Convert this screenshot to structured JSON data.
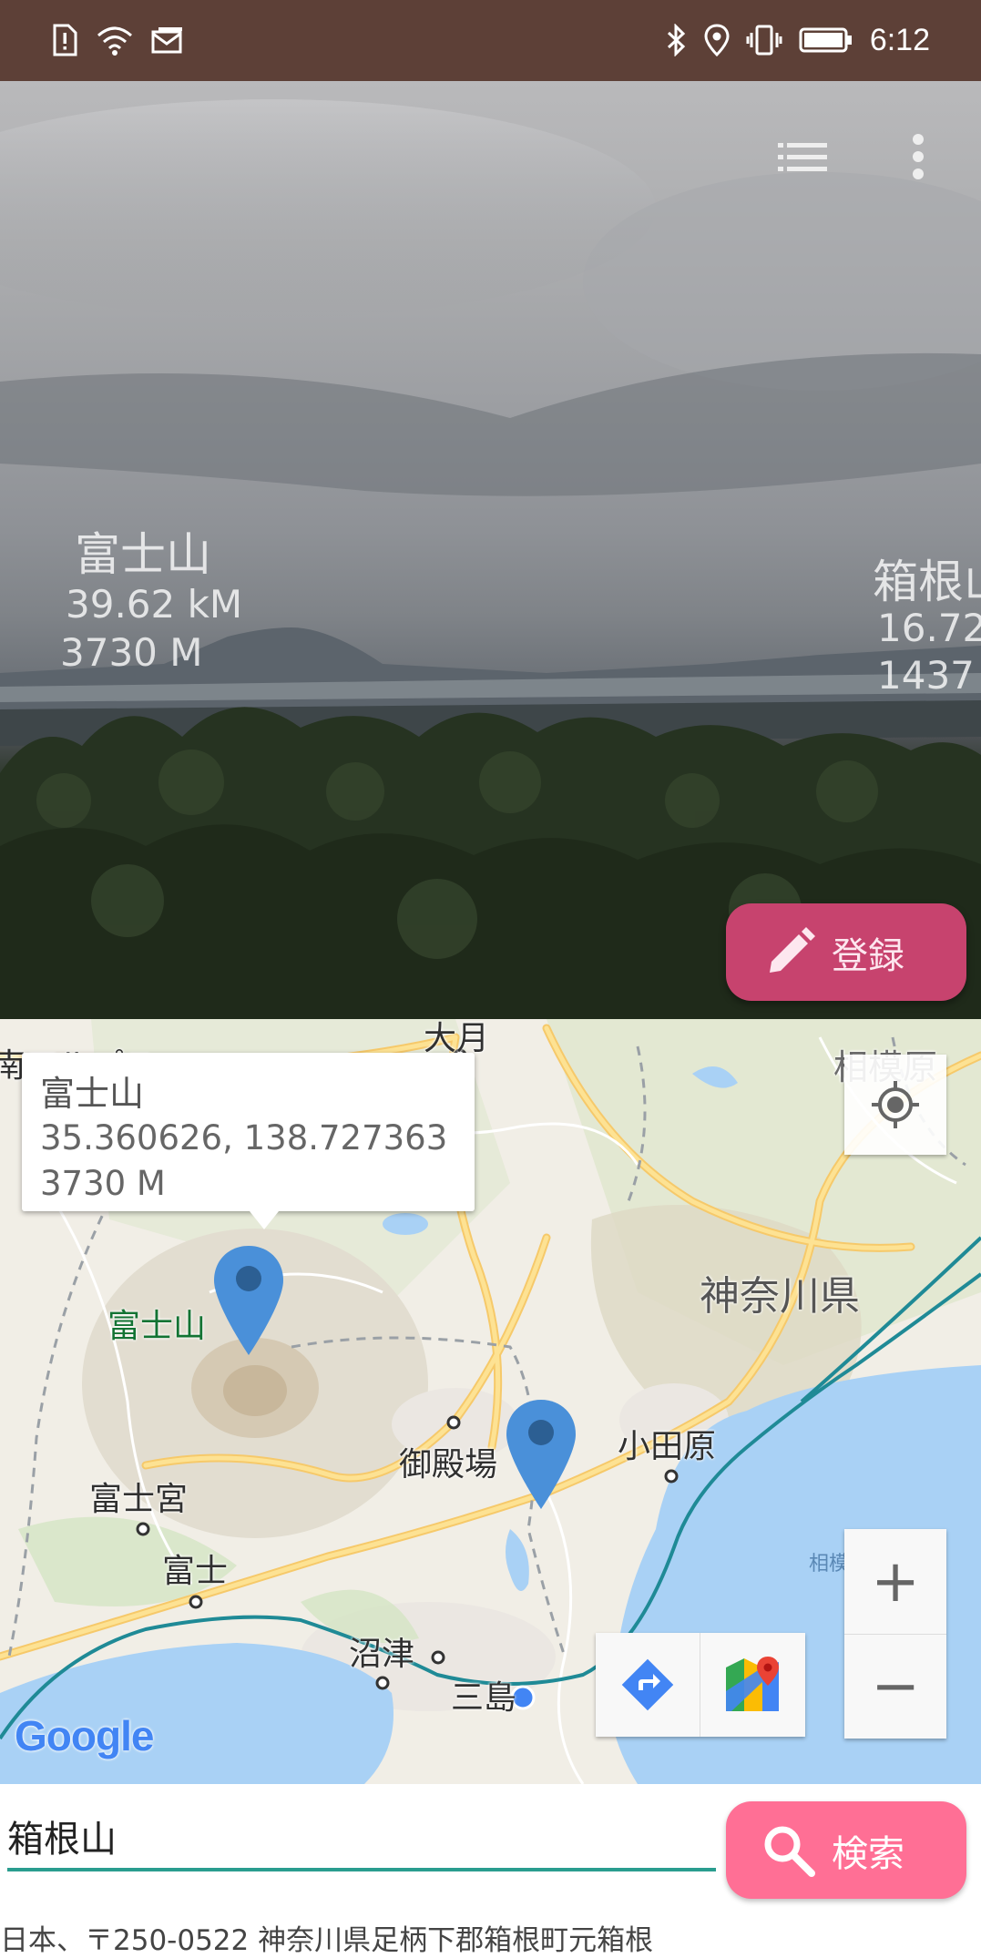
{
  "status_bar": {
    "time": "6:12",
    "left_icons": [
      "alert-icon",
      "wifi-icon",
      "mail-icon"
    ],
    "right_icons": [
      "bluetooth-icon",
      "location-icon",
      "vibrate-icon",
      "battery-icon"
    ],
    "background_color": "#5d4037"
  },
  "camera": {
    "toolbar": {
      "list_icon": "list-icon",
      "menu_icon": "more-vert-icon"
    },
    "ar_labels": [
      {
        "name": "富士山",
        "distance": "39.62 kM",
        "elevation": "3730 M"
      },
      {
        "name": "箱根山",
        "distance": "16.72",
        "elevation": "1437"
      }
    ],
    "register_button": {
      "label": "登録",
      "icon": "pencil-icon",
      "color": "#c7436e"
    }
  },
  "map": {
    "place_labels": [
      {
        "id": "minami-alps",
        "text": "南アルプス"
      },
      {
        "id": "otsuki",
        "text": "大月"
      },
      {
        "id": "sagamihara",
        "text": "相模原"
      },
      {
        "id": "kanagawa",
        "text": "神奈川県"
      },
      {
        "id": "fujisan",
        "text": "富士山"
      },
      {
        "id": "gotemba",
        "text": "御殿場"
      },
      {
        "id": "odawara",
        "text": "小田原"
      },
      {
        "id": "fujinomiya",
        "text": "富士宮"
      },
      {
        "id": "fuji",
        "text": "富士"
      },
      {
        "id": "numazu",
        "text": "沼津"
      },
      {
        "id": "mishima",
        "text": "三島"
      },
      {
        "id": "sagami-bay",
        "text": "相模湾"
      }
    ],
    "info_window": {
      "title": "富士山",
      "coordinates": "35.360626, 138.727363",
      "elevation": "3730 M"
    },
    "markers": [
      "fuji-marker",
      "hakone-marker"
    ],
    "controls": {
      "my_location_icon": "my-location-icon",
      "zoom_in": "+",
      "zoom_out": "−",
      "directions_icon": "directions-icon",
      "maps_app_icon": "google-maps-icon"
    },
    "logo": "Google"
  },
  "search": {
    "value": "箱根山",
    "button_label": "検索",
    "button_icon": "search-icon",
    "button_color": "#ff6f95",
    "address": "日本、〒250-0522 神奈川県足柄下郡箱根町元箱根"
  }
}
